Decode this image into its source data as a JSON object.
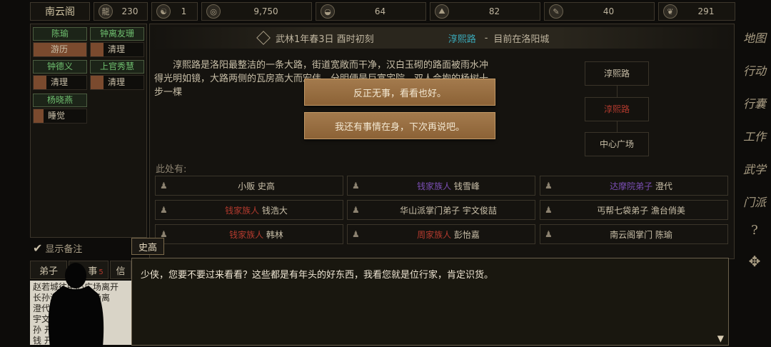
{
  "top_bar": {
    "location": "南云阁",
    "stats": [
      {
        "icon": "dragon-icon",
        "glyph": "龍",
        "value": "230"
      },
      {
        "icon": "yinyang-icon",
        "glyph": "☯",
        "value": "1"
      },
      {
        "icon": "coin-icon",
        "glyph": "◎",
        "value": "9,750"
      },
      {
        "icon": "food-bowl-icon",
        "glyph": "◒",
        "value": "64"
      },
      {
        "icon": "meditation-icon",
        "glyph": "⛰",
        "value": "82"
      },
      {
        "icon": "brush-icon",
        "glyph": "✎",
        "value": "40"
      },
      {
        "icon": "heart-icon",
        "glyph": "❦",
        "value": "291"
      }
    ]
  },
  "party": [
    {
      "name": "陈瑜",
      "status": "游历",
      "name_color": "#6fbf6f"
    },
    {
      "name": "钟离友珊",
      "status": "清理",
      "name_color": "#6fbf6f"
    },
    {
      "name": "钟德义",
      "status": "清理",
      "name_color": "#6fbf6f"
    },
    {
      "name": "上官秀慧",
      "status": "清理",
      "name_color": "#6fbf6f"
    },
    {
      "name": "杨晓燕",
      "status": "睡觉",
      "name_color": "#6fbf6f"
    }
  ],
  "header": {
    "date": "武林1年春3日 酉时初刻",
    "road": "淳熙路",
    "dash": "-",
    "current": "目前在洛阳城"
  },
  "description": "淳熙路是洛阳最整洁的一条大路，街道宽敞而干净，汉白玉砌的路面被雨水冲得光明如镜，大路两侧的瓦房高大而宏伟，分明便是巨富宅院。双人合抱的杨树十步一棵",
  "map_nodes": [
    "淳熙路",
    "淳熙路",
    "中心广场"
  ],
  "here_label": "此处有:",
  "people": [
    {
      "faction": "",
      "name": "小贩 史高",
      "faction_class": "fac-normal"
    },
    {
      "faction": "钱家族人",
      "name": "钱雪峰",
      "faction_class": "fac-purple"
    },
    {
      "faction": "达摩院弟子",
      "name": "澄代",
      "faction_class": "fac-purple"
    },
    {
      "faction": "钱家族人",
      "name": "钱浩大",
      "faction_class": "fac-red"
    },
    {
      "faction": "华山派掌门弟子",
      "name": "宇文俊喆",
      "faction_class": "fac-normal"
    },
    {
      "faction": "丐帮七袋弟子",
      "name": "澹台俏美",
      "faction_class": "fac-normal"
    },
    {
      "faction": "钱家族人",
      "name": "韩林",
      "faction_class": "fac-red"
    },
    {
      "faction": "周家族人",
      "name": "彭怡嘉",
      "faction_class": "fac-red"
    },
    {
      "faction": "",
      "name": "南云阁掌门 陈瑜",
      "faction_class": "fac-normal"
    }
  ],
  "choices": [
    "反正无事，看看也好。",
    "我还有事情在身，下次再说吧。"
  ],
  "show_notes": "显示备注",
  "tabs": {
    "disciples": "弟子",
    "events": "事",
    "events_count": "5",
    "letters": "信"
  },
  "log_lines": [
    "赵若城往中心广场离开",
    "长孙淑往中心广场离",
    "澄代 走了",
    "宇文 手执",
    "孙 开。",
    "钱 开。"
  ],
  "dialog": {
    "speaker": "史高",
    "text": "少侠，您要不要过来看看？这些都是有年头的好东西，我看您就是位行家，肯定识货。",
    "continue_glyph": "▼"
  },
  "right_menu": [
    {
      "label": "地图",
      "icon": "map-icon"
    },
    {
      "label": "行动",
      "icon": "action-icon"
    },
    {
      "label": "行囊",
      "icon": "bag-icon"
    },
    {
      "label": "工作",
      "icon": "work-icon"
    },
    {
      "label": "武学",
      "icon": "martial-icon"
    },
    {
      "label": "门派",
      "icon": "sect-icon"
    },
    {
      "label": "?",
      "icon": "help-icon"
    },
    {
      "label": "✥",
      "icon": "settings-icon"
    }
  ]
}
